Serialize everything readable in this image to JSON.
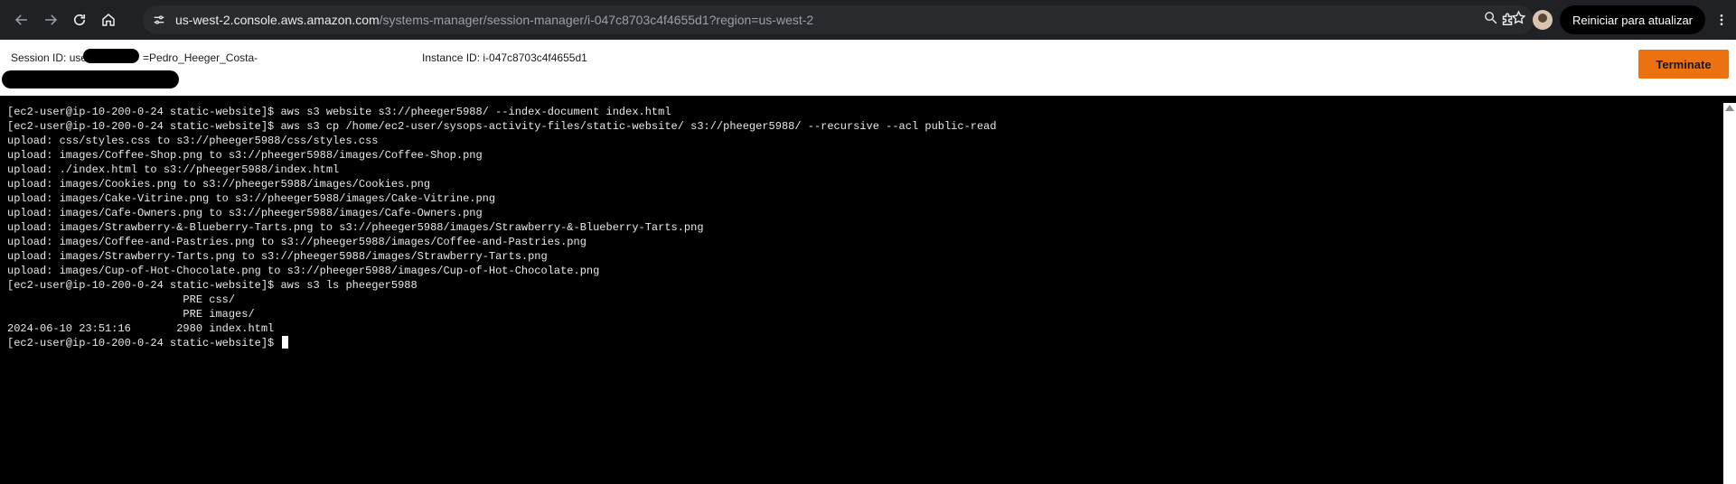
{
  "browser": {
    "url_host": "us-west-2.console.aws.amazon.com",
    "url_path": "/systems-manager/session-manager/i-047c8703c4f4655d1?region=us-west-2",
    "update_button": "Reiniciar para atualizar"
  },
  "session": {
    "session_id_prefix": "Session ID: use",
    "session_id_suffix": "=Pedro_Heeger_Costa-",
    "instance_id": "Instance ID: i-047c8703c4f4655d1",
    "terminate_label": "Terminate"
  },
  "terminal": {
    "lines": [
      "[ec2-user@ip-10-200-0-24 static-website]$ aws s3 website s3://pheeger5988/ --index-document index.html",
      "[ec2-user@ip-10-200-0-24 static-website]$ aws s3 cp /home/ec2-user/sysops-activity-files/static-website/ s3://pheeger5988/ --recursive --acl public-read",
      "upload: css/styles.css to s3://pheeger5988/css/styles.css",
      "upload: images/Coffee-Shop.png to s3://pheeger5988/images/Coffee-Shop.png",
      "upload: ./index.html to s3://pheeger5988/index.html",
      "upload: images/Cookies.png to s3://pheeger5988/images/Cookies.png",
      "upload: images/Cake-Vitrine.png to s3://pheeger5988/images/Cake-Vitrine.png",
      "upload: images/Cafe-Owners.png to s3://pheeger5988/images/Cafe-Owners.png",
      "upload: images/Strawberry-&-Blueberry-Tarts.png to s3://pheeger5988/images/Strawberry-&-Blueberry-Tarts.png",
      "upload: images/Coffee-and-Pastries.png to s3://pheeger5988/images/Coffee-and-Pastries.png",
      "upload: images/Strawberry-Tarts.png to s3://pheeger5988/images/Strawberry-Tarts.png",
      "upload: images/Cup-of-Hot-Chocolate.png to s3://pheeger5988/images/Cup-of-Hot-Chocolate.png",
      "[ec2-user@ip-10-200-0-24 static-website]$ aws s3 ls pheeger5988",
      "                           PRE css/",
      "                           PRE images/",
      "2024-06-10 23:51:16       2980 index.html"
    ],
    "prompt": "[ec2-user@ip-10-200-0-24 static-website]$ "
  },
  "colors": {
    "terminate": "#ec7211",
    "chrome_bg": "#202124",
    "terminal_bg": "#000000"
  },
  "icons": [
    "back-icon",
    "forward-icon",
    "reload-icon",
    "home-icon",
    "site-info-icon",
    "zoom-icon",
    "bookmark-star-icon",
    "extensions-icon",
    "profile-avatar",
    "menu-kebab-icon"
  ]
}
